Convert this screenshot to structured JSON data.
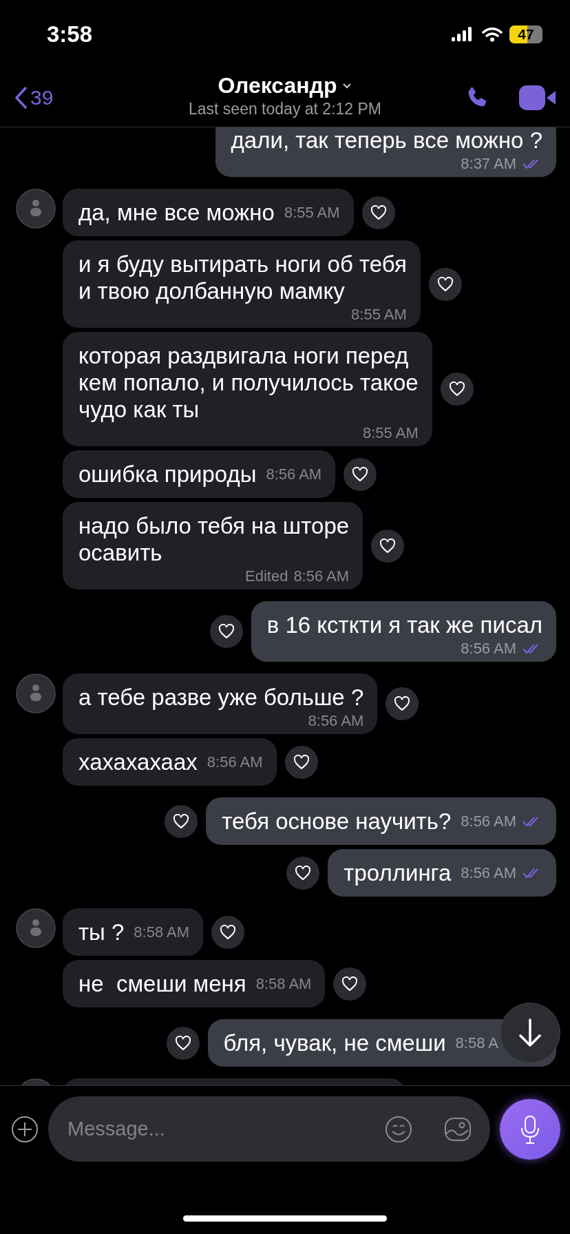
{
  "status_bar": {
    "time": "3:58",
    "battery": "47"
  },
  "header": {
    "back_count": "39",
    "title": "Олександр",
    "subtitle": "Last seen today at 2:12 PM"
  },
  "messages": [
    {
      "outgoing": true,
      "like_button": false,
      "kind": "stacked",
      "text": "дали, так теперь все можно ?",
      "time": "8:37 AM",
      "read": true
    },
    {
      "outgoing": false,
      "like_button": true,
      "kind": "inline",
      "avatar": true,
      "text": "да, мне все можно",
      "time": "8:55 AM"
    },
    {
      "outgoing": false,
      "like_button": true,
      "kind": "stacked",
      "avatar": false,
      "text": "и я буду вытирать ноги об тебя\nи твою долбанную мамку",
      "time": "8:55 AM"
    },
    {
      "outgoing": false,
      "like_button": true,
      "kind": "stacked",
      "avatar": false,
      "text": "которая раздвигала ноги перед\nкем попало, и получилось такое\nчудо как ты",
      "time": "8:55 AM"
    },
    {
      "outgoing": false,
      "like_button": true,
      "kind": "inline",
      "avatar": false,
      "text": "ошибка природы",
      "time": "8:56 AM"
    },
    {
      "outgoing": false,
      "like_button": true,
      "kind": "stacked",
      "avatar": false,
      "text": "надо было тебя на шторе\nосавить",
      "edited": "Edited",
      "time": "8:56 AM"
    },
    {
      "outgoing": true,
      "like_button": true,
      "kind": "stacked",
      "text": "в 16 ксткти я так же писал",
      "time": "8:56 AM",
      "read": true
    },
    {
      "outgoing": false,
      "like_button": true,
      "kind": "stacked",
      "avatar": true,
      "text": "а тебе разве уже больше ?",
      "time": "8:56 AM"
    },
    {
      "outgoing": false,
      "like_button": true,
      "kind": "inline",
      "avatar": false,
      "text": "хахахахаах",
      "time": "8:56 AM"
    },
    {
      "outgoing": true,
      "like_button": true,
      "kind": "inline",
      "text": "тебя основе научить?",
      "time": "8:56 AM",
      "read": true
    },
    {
      "outgoing": true,
      "like_button": true,
      "kind": "inline",
      "text": "троллинга",
      "time": "8:56 AM",
      "read": true
    },
    {
      "outgoing": false,
      "like_button": true,
      "kind": "inline",
      "avatar": true,
      "text": "ты ?",
      "time": "8:58 AM"
    },
    {
      "outgoing": false,
      "like_button": true,
      "kind": "inline",
      "avatar": false,
      "text": "не  смеши меня",
      "time": "8:58 AM"
    },
    {
      "outgoing": true,
      "like_button": true,
      "kind": "inline",
      "text": "бля, чувак, не смеши",
      "time": "8:58 A",
      "read": false
    },
    {
      "outgoing": false,
      "kind": "cut-off",
      "avatar": true
    }
  ],
  "composer": {
    "placeholder": "Message..."
  }
}
